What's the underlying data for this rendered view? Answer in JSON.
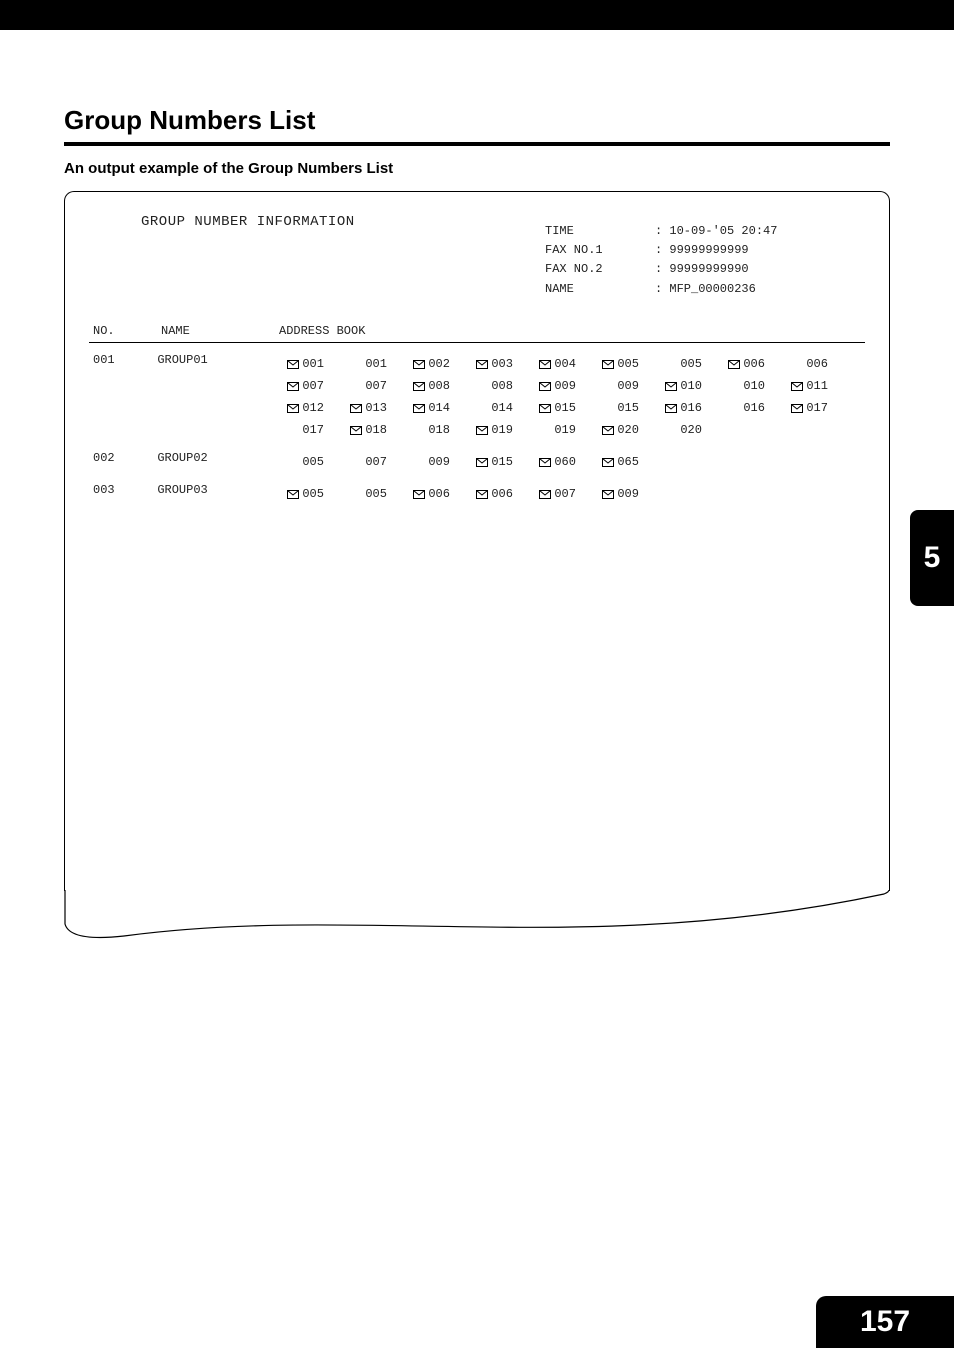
{
  "page": {
    "heading": "Group Numbers List",
    "subheading": "An output example of the Group Numbers List",
    "chapter_tab": "5",
    "page_number": "157"
  },
  "report": {
    "title": "GROUP NUMBER INFORMATION",
    "meta": {
      "time_label": "TIME",
      "time_value": ": 10-09-'05 20:47",
      "fax1_label": "FAX NO.1",
      "fax1_value": ": 99999999999",
      "fax2_label": "FAX NO.2",
      "fax2_value": ": 99999999990",
      "name_label": "NAME",
      "name_value": ": MFP_00000236"
    },
    "columns": {
      "no": "NO.",
      "name": "NAME",
      "address_book": "ADDRESS BOOK"
    },
    "groups": [
      {
        "no": "001",
        "name": "GROUP01",
        "entries": [
          {
            "id": "001",
            "mail": true
          },
          {
            "id": "001",
            "mail": false
          },
          {
            "id": "002",
            "mail": true
          },
          {
            "id": "003",
            "mail": true
          },
          {
            "id": "004",
            "mail": true
          },
          {
            "id": "005",
            "mail": true
          },
          {
            "id": "005",
            "mail": false
          },
          {
            "id": "006",
            "mail": true
          },
          {
            "id": "006",
            "mail": false
          },
          {
            "id": "007",
            "mail": true
          },
          {
            "id": "007",
            "mail": false
          },
          {
            "id": "008",
            "mail": true
          },
          {
            "id": "008",
            "mail": false
          },
          {
            "id": "009",
            "mail": true
          },
          {
            "id": "009",
            "mail": false
          },
          {
            "id": "010",
            "mail": true
          },
          {
            "id": "010",
            "mail": false
          },
          {
            "id": "011",
            "mail": true
          },
          {
            "id": "012",
            "mail": true
          },
          {
            "id": "013",
            "mail": true
          },
          {
            "id": "014",
            "mail": true
          },
          {
            "id": "014",
            "mail": false
          },
          {
            "id": "015",
            "mail": true
          },
          {
            "id": "015",
            "mail": false
          },
          {
            "id": "016",
            "mail": true
          },
          {
            "id": "016",
            "mail": false
          },
          {
            "id": "017",
            "mail": true
          },
          {
            "id": "017",
            "mail": false
          },
          {
            "id": "018",
            "mail": true
          },
          {
            "id": "018",
            "mail": false
          },
          {
            "id": "019",
            "mail": true
          },
          {
            "id": "019",
            "mail": false
          },
          {
            "id": "020",
            "mail": true
          },
          {
            "id": "020",
            "mail": false
          }
        ]
      },
      {
        "no": "002",
        "name": "GROUP02",
        "entries": [
          {
            "id": "005",
            "mail": false
          },
          {
            "id": "007",
            "mail": false
          },
          {
            "id": "009",
            "mail": false
          },
          {
            "id": "015",
            "mail": true
          },
          {
            "id": "060",
            "mail": true
          },
          {
            "id": "065",
            "mail": true
          }
        ]
      },
      {
        "no": "003",
        "name": "GROUP03",
        "entries": [
          {
            "id": "005",
            "mail": true
          },
          {
            "id": "005",
            "mail": false
          },
          {
            "id": "006",
            "mail": true
          },
          {
            "id": "006",
            "mail": true
          },
          {
            "id": "007",
            "mail": true
          },
          {
            "id": "009",
            "mail": true
          }
        ]
      }
    ]
  }
}
